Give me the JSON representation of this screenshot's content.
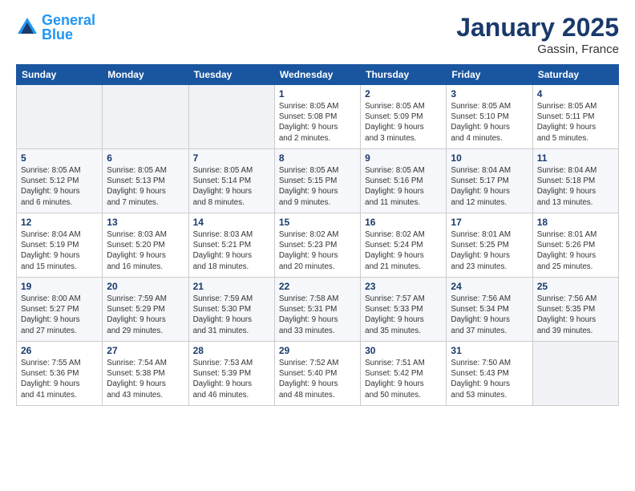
{
  "header": {
    "logo_text_general": "General",
    "logo_text_blue": "Blue",
    "month": "January 2025",
    "location": "Gassin, France"
  },
  "days_of_week": [
    "Sunday",
    "Monday",
    "Tuesday",
    "Wednesday",
    "Thursday",
    "Friday",
    "Saturday"
  ],
  "weeks": [
    [
      {
        "num": "",
        "info": ""
      },
      {
        "num": "",
        "info": ""
      },
      {
        "num": "",
        "info": ""
      },
      {
        "num": "1",
        "info": "Sunrise: 8:05 AM\nSunset: 5:08 PM\nDaylight: 9 hours\nand 2 minutes."
      },
      {
        "num": "2",
        "info": "Sunrise: 8:05 AM\nSunset: 5:09 PM\nDaylight: 9 hours\nand 3 minutes."
      },
      {
        "num": "3",
        "info": "Sunrise: 8:05 AM\nSunset: 5:10 PM\nDaylight: 9 hours\nand 4 minutes."
      },
      {
        "num": "4",
        "info": "Sunrise: 8:05 AM\nSunset: 5:11 PM\nDaylight: 9 hours\nand 5 minutes."
      }
    ],
    [
      {
        "num": "5",
        "info": "Sunrise: 8:05 AM\nSunset: 5:12 PM\nDaylight: 9 hours\nand 6 minutes."
      },
      {
        "num": "6",
        "info": "Sunrise: 8:05 AM\nSunset: 5:13 PM\nDaylight: 9 hours\nand 7 minutes."
      },
      {
        "num": "7",
        "info": "Sunrise: 8:05 AM\nSunset: 5:14 PM\nDaylight: 9 hours\nand 8 minutes."
      },
      {
        "num": "8",
        "info": "Sunrise: 8:05 AM\nSunset: 5:15 PM\nDaylight: 9 hours\nand 9 minutes."
      },
      {
        "num": "9",
        "info": "Sunrise: 8:05 AM\nSunset: 5:16 PM\nDaylight: 9 hours\nand 11 minutes."
      },
      {
        "num": "10",
        "info": "Sunrise: 8:04 AM\nSunset: 5:17 PM\nDaylight: 9 hours\nand 12 minutes."
      },
      {
        "num": "11",
        "info": "Sunrise: 8:04 AM\nSunset: 5:18 PM\nDaylight: 9 hours\nand 13 minutes."
      }
    ],
    [
      {
        "num": "12",
        "info": "Sunrise: 8:04 AM\nSunset: 5:19 PM\nDaylight: 9 hours\nand 15 minutes."
      },
      {
        "num": "13",
        "info": "Sunrise: 8:03 AM\nSunset: 5:20 PM\nDaylight: 9 hours\nand 16 minutes."
      },
      {
        "num": "14",
        "info": "Sunrise: 8:03 AM\nSunset: 5:21 PM\nDaylight: 9 hours\nand 18 minutes."
      },
      {
        "num": "15",
        "info": "Sunrise: 8:02 AM\nSunset: 5:23 PM\nDaylight: 9 hours\nand 20 minutes."
      },
      {
        "num": "16",
        "info": "Sunrise: 8:02 AM\nSunset: 5:24 PM\nDaylight: 9 hours\nand 21 minutes."
      },
      {
        "num": "17",
        "info": "Sunrise: 8:01 AM\nSunset: 5:25 PM\nDaylight: 9 hours\nand 23 minutes."
      },
      {
        "num": "18",
        "info": "Sunrise: 8:01 AM\nSunset: 5:26 PM\nDaylight: 9 hours\nand 25 minutes."
      }
    ],
    [
      {
        "num": "19",
        "info": "Sunrise: 8:00 AM\nSunset: 5:27 PM\nDaylight: 9 hours\nand 27 minutes."
      },
      {
        "num": "20",
        "info": "Sunrise: 7:59 AM\nSunset: 5:29 PM\nDaylight: 9 hours\nand 29 minutes."
      },
      {
        "num": "21",
        "info": "Sunrise: 7:59 AM\nSunset: 5:30 PM\nDaylight: 9 hours\nand 31 minutes."
      },
      {
        "num": "22",
        "info": "Sunrise: 7:58 AM\nSunset: 5:31 PM\nDaylight: 9 hours\nand 33 minutes."
      },
      {
        "num": "23",
        "info": "Sunrise: 7:57 AM\nSunset: 5:33 PM\nDaylight: 9 hours\nand 35 minutes."
      },
      {
        "num": "24",
        "info": "Sunrise: 7:56 AM\nSunset: 5:34 PM\nDaylight: 9 hours\nand 37 minutes."
      },
      {
        "num": "25",
        "info": "Sunrise: 7:56 AM\nSunset: 5:35 PM\nDaylight: 9 hours\nand 39 minutes."
      }
    ],
    [
      {
        "num": "26",
        "info": "Sunrise: 7:55 AM\nSunset: 5:36 PM\nDaylight: 9 hours\nand 41 minutes."
      },
      {
        "num": "27",
        "info": "Sunrise: 7:54 AM\nSunset: 5:38 PM\nDaylight: 9 hours\nand 43 minutes."
      },
      {
        "num": "28",
        "info": "Sunrise: 7:53 AM\nSunset: 5:39 PM\nDaylight: 9 hours\nand 46 minutes."
      },
      {
        "num": "29",
        "info": "Sunrise: 7:52 AM\nSunset: 5:40 PM\nDaylight: 9 hours\nand 48 minutes."
      },
      {
        "num": "30",
        "info": "Sunrise: 7:51 AM\nSunset: 5:42 PM\nDaylight: 9 hours\nand 50 minutes."
      },
      {
        "num": "31",
        "info": "Sunrise: 7:50 AM\nSunset: 5:43 PM\nDaylight: 9 hours\nand 53 minutes."
      },
      {
        "num": "",
        "info": ""
      }
    ]
  ]
}
